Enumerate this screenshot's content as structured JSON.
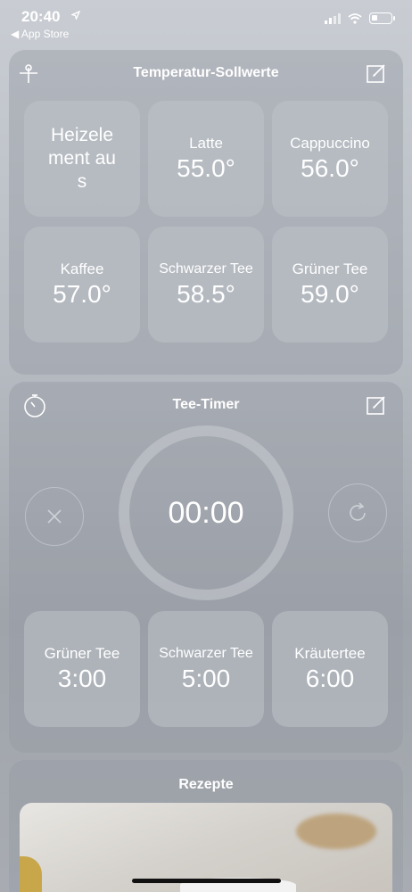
{
  "status": {
    "time": "20:40",
    "back_app": "◀ App Store"
  },
  "temperature": {
    "title": "Temperatur-Sollwerte",
    "tiles": [
      {
        "label": "Heizelement aus",
        "value": ""
      },
      {
        "label": "Latte",
        "value": "55.0°"
      },
      {
        "label": "Cappuccino",
        "value": "56.0°"
      },
      {
        "label": "Kaffee",
        "value": "57.0°"
      },
      {
        "label": "Schwarzer Tee",
        "value": "58.5°"
      },
      {
        "label": "Grüner Tee",
        "value": "59.0°"
      }
    ]
  },
  "timer": {
    "title": "Tee-Timer",
    "display": "00:00",
    "presets": [
      {
        "label": "Grüner Tee",
        "value": "3:00"
      },
      {
        "label": "Schwarzer Tee",
        "value": "5:00"
      },
      {
        "label": "Kräutertee",
        "value": "6:00"
      }
    ]
  },
  "recipes": {
    "title": "Rezepte"
  },
  "icons": {
    "pin": "pin-icon",
    "edit": "edit-icon",
    "stopwatch": "stopwatch-icon",
    "cancel": "close-icon",
    "reset": "refresh-icon"
  }
}
